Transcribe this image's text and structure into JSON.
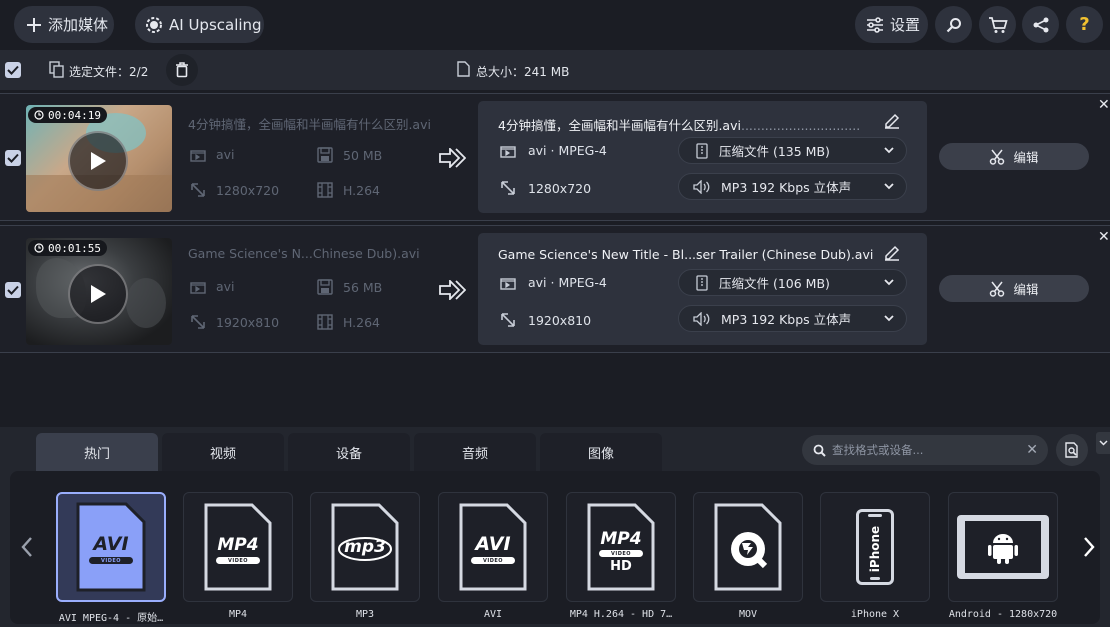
{
  "toolbar": {
    "add_media": "添加媒体",
    "ai_upscaling": "AI Upscaling",
    "settings": "设置",
    "help": "?"
  },
  "selection": {
    "selected_label": "选定文件：",
    "selected_count": "2/2",
    "total_label": "总大小：",
    "total_size": "241 MB"
  },
  "files": [
    {
      "duration": "00:04:19",
      "source_name": "4分钟搞懂，全画幅和半画幅有什么区别.avi",
      "source_format": "avi",
      "source_size": "50 MB",
      "source_resolution": "1280x720",
      "source_codec": "H.264",
      "output_name": "4分钟搞懂，全画幅和半画幅有什么区别.avi",
      "output_dots": "..............................",
      "output_format": "avi · MPEG-4",
      "output_resolution": "1280x720",
      "compress": "压缩文件 (135 MB)",
      "audio": "MP3 192 Kbps 立体声",
      "edit": "编辑"
    },
    {
      "duration": "00:01:55",
      "source_name": "Game Science's N...Chinese Dub).avi",
      "source_format": "avi",
      "source_size": "56 MB",
      "source_resolution": "1920x810",
      "source_codec": "H.264",
      "output_name": "Game Science's New Title - Bl...ser Trailer (Chinese Dub).avi",
      "output_dots": "",
      "output_format": "avi · MPEG-4",
      "output_resolution": "1920x810",
      "compress": "压缩文件 (106 MB)",
      "audio": "MP3 192 Kbps 立体声",
      "edit": "编辑"
    }
  ],
  "format_tabs": [
    "热门",
    "视频",
    "设备",
    "音频",
    "图像"
  ],
  "search": {
    "placeholder": "查找格式或设备..."
  },
  "formats": [
    {
      "label": "AVI MPEG-4 - 原始…",
      "badge": "AVI",
      "sub": "VIDEO",
      "icon": "avi-file-icon"
    },
    {
      "label": "MP4",
      "badge": "MP4",
      "sub": "VIDEO",
      "icon": "mp4-file-icon"
    },
    {
      "label": "MP3",
      "badge": "mp3",
      "sub": "",
      "icon": "mp3-file-icon"
    },
    {
      "label": "AVI",
      "badge": "AVI",
      "sub": "VIDEO",
      "icon": "avi-file-icon"
    },
    {
      "label": "MP4 H.264 - HD 7…",
      "badge": "MP4",
      "sub": "VIDEO",
      "extra": "HD",
      "icon": "mp4-hd-file-icon"
    },
    {
      "label": "MOV",
      "badge": "",
      "sub": "",
      "icon": "quicktime-icon"
    },
    {
      "label": "iPhone X",
      "badge": "iPhone",
      "sub": "",
      "icon": "iphone-icon"
    },
    {
      "label": "Android - 1280x720",
      "badge": "",
      "sub": "",
      "icon": "android-tablet-icon"
    }
  ],
  "colors": {
    "accent_blue": "#9aaefc",
    "help_yellow": "#f2c230",
    "panel_bg": "#2e323d"
  }
}
